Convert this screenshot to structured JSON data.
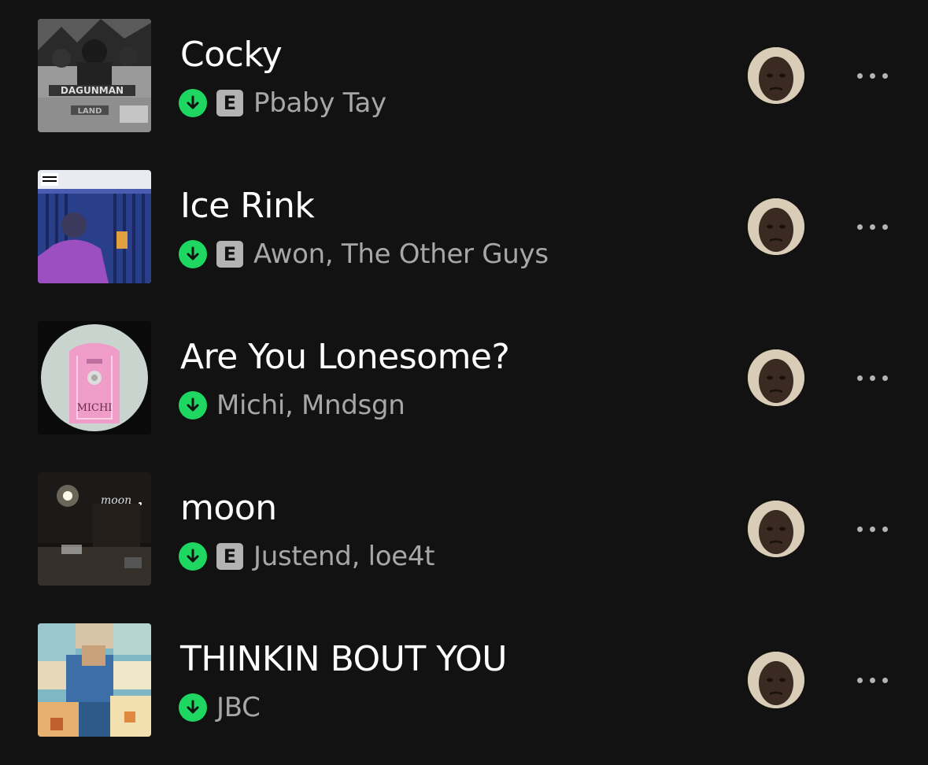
{
  "tracks": [
    {
      "title": "Cocky",
      "artists": "Pbaby Tay",
      "explicit": true,
      "downloaded": true,
      "cover_icon": "album-art-dagunman-land"
    },
    {
      "title": "Ice Rink",
      "artists": "Awon, The Other Guys",
      "explicit": true,
      "downloaded": true,
      "cover_icon": "album-art-ice-rink"
    },
    {
      "title": "Are You Lonesome?",
      "artists": "Michi, Mndsgn",
      "explicit": false,
      "downloaded": true,
      "cover_icon": "album-art-vinyl-label"
    },
    {
      "title": "moon",
      "artists": "Justend, loe4t",
      "explicit": true,
      "downloaded": true,
      "cover_icon": "album-art-moon-street"
    },
    {
      "title": "THINKIN BOUT YOU",
      "artists": "JBC",
      "explicit": false,
      "downloaded": true,
      "cover_icon": "album-art-pixel-portrait"
    }
  ],
  "explicit_label": "E",
  "colors": {
    "background": "#121212",
    "download_green": "#1ed760",
    "subtext": "#a7a7a7"
  }
}
